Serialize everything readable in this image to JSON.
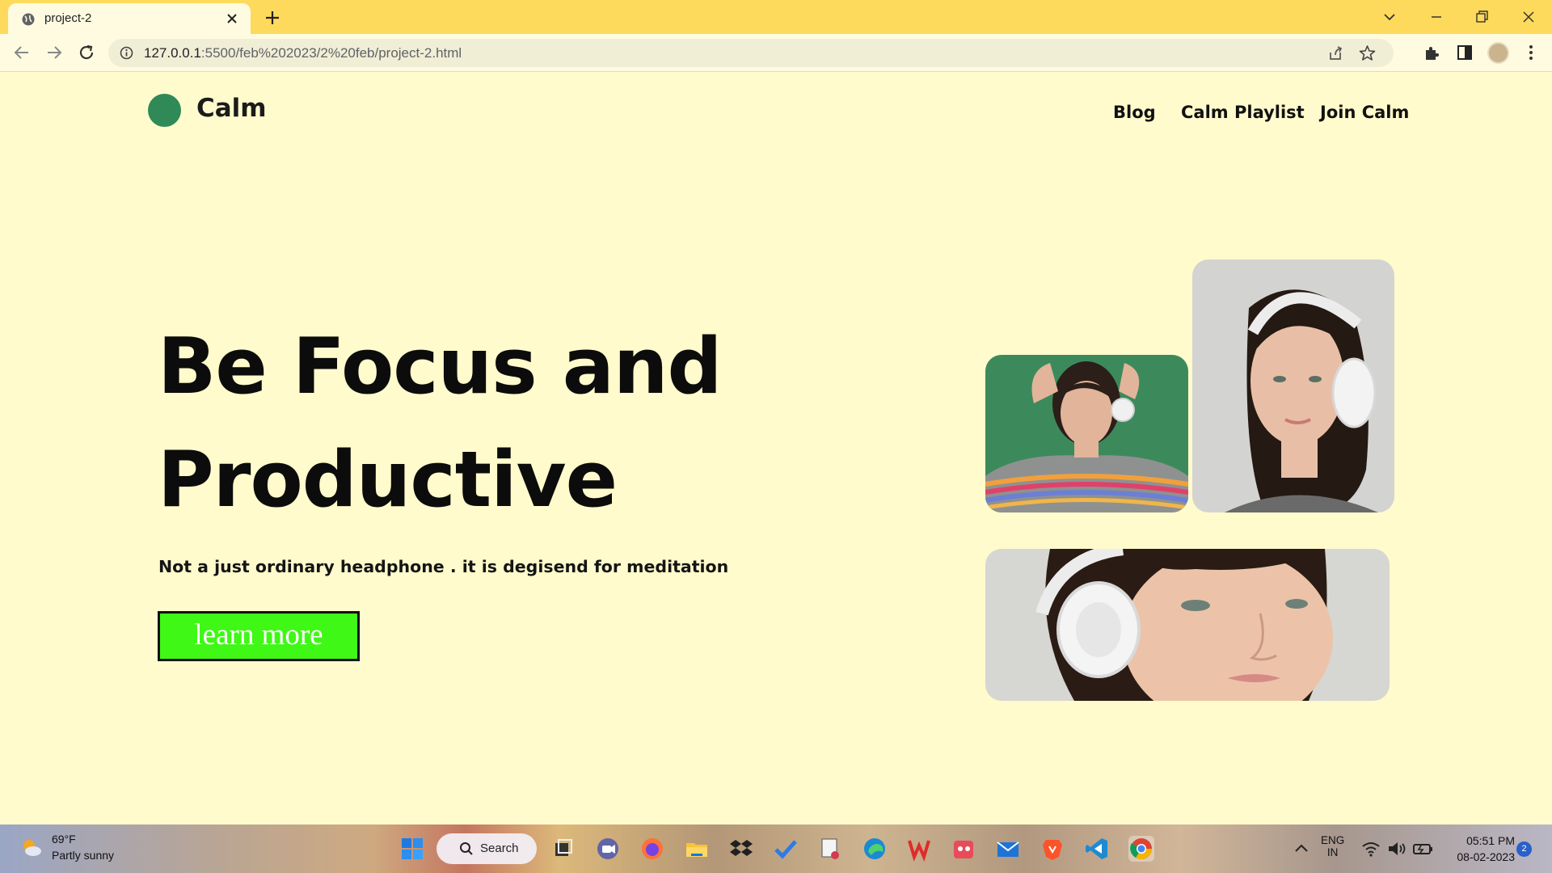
{
  "browser": {
    "tab_title": "project-2",
    "url_host": "127.0.0.1",
    "url_path": ":5500/feb%202023/2%20feb/project-2.html"
  },
  "site": {
    "logo_text": "Calm",
    "nav": [
      "Blog",
      "Calm Playlist",
      "Join Calm"
    ],
    "hero_title_line1": "Be Focus and",
    "hero_title_line2": "Productive",
    "hero_subtitle": "Not a just ordinary headphone . it is degisend for meditation",
    "cta_label": "learn more",
    "colors": {
      "background": "#fffbcc",
      "logo_dot": "#2f8a57",
      "cta_bg": "#3ff816",
      "tab_strip": "#fdda5c"
    }
  },
  "taskbar": {
    "weather_temp": "69°F",
    "weather_condition": "Partly sunny",
    "search_label": "Search",
    "lang_line1": "ENG",
    "lang_line2": "IN",
    "time": "05:51 PM",
    "date": "08-02-2023",
    "notification_count": "2"
  }
}
